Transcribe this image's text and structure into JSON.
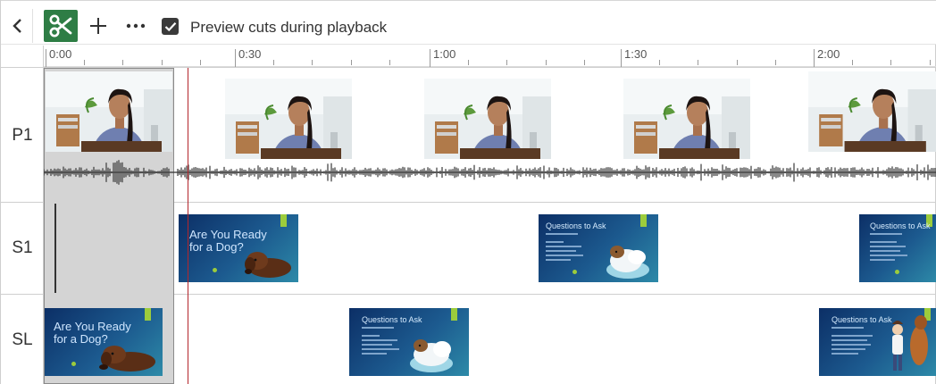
{
  "toolbar": {
    "back_icon": "chevron-left-icon",
    "cut_icon": "scissors-icon",
    "add_icon": "plus-icon",
    "more_icon": "ellipsis-icon",
    "preview_checkbox": {
      "checked": true,
      "label": "Preview cuts during playback"
    },
    "accent_color": "#2e7d45"
  },
  "ruler": {
    "labels": [
      "0:00",
      "0:30",
      "1:00",
      "1:30",
      "2:00"
    ]
  },
  "tracks": [
    {
      "label": "P1"
    },
    {
      "label": "S1"
    },
    {
      "label": "SL"
    }
  ],
  "slides": {
    "dog_title": "Are You Ready for a Dog?",
    "questions_title": "Questions to Ask"
  },
  "playhead_color": "#b3262c"
}
